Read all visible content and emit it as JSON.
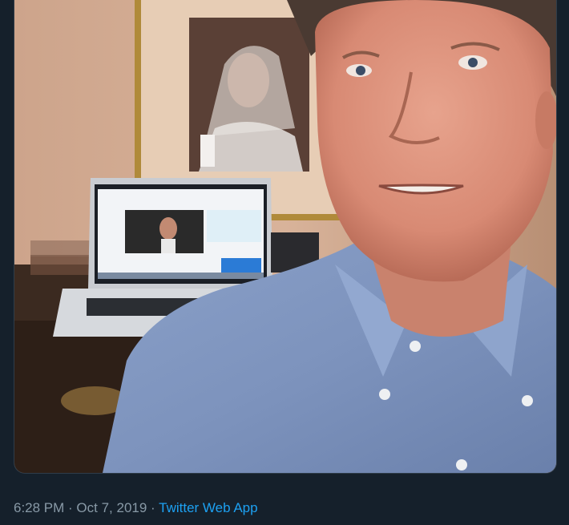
{
  "tweet": {
    "time": "6:28 PM",
    "separator1": " · ",
    "date": "Oct 7, 2019",
    "separator2": " · ",
    "source": "Twitter Web App"
  },
  "colors": {
    "background": "#15202b",
    "meta_text": "#8899a6",
    "link": "#1da1f2"
  }
}
